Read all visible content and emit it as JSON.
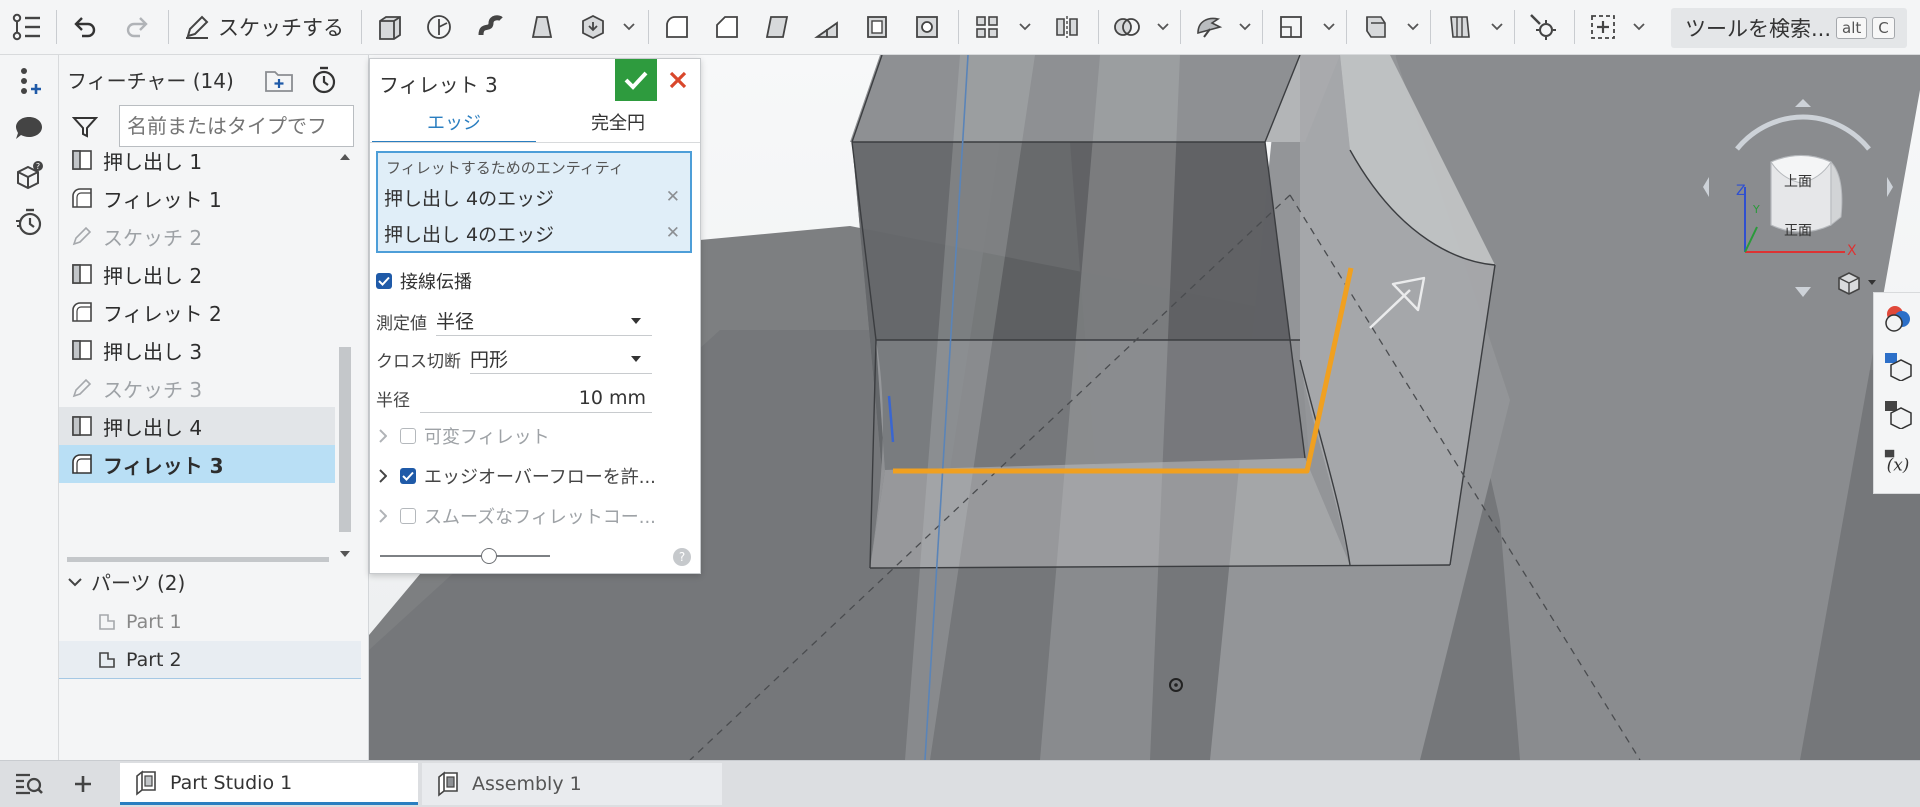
{
  "toolbar": {
    "sketch_label": "スケッチする",
    "search_label": "ツールを検索...",
    "search_key1": "alt",
    "search_key2": "C"
  },
  "feature_panel": {
    "title": "フィーチャー (14)",
    "filter_placeholder": "名前またはタイプでフ",
    "features": [
      {
        "label": "押し出し 1",
        "icon": "extrude-icon",
        "state": "normal"
      },
      {
        "label": "フィレット 1",
        "icon": "fillet-icon",
        "state": "normal"
      },
      {
        "label": "スケッチ 2",
        "icon": "sketch-icon",
        "state": "dim"
      },
      {
        "label": "押し出し 2",
        "icon": "extrude-icon",
        "state": "normal"
      },
      {
        "label": "フィレット 2",
        "icon": "fillet-icon",
        "state": "normal"
      },
      {
        "label": "押し出し 3",
        "icon": "extrude-icon",
        "state": "normal"
      },
      {
        "label": "スケッチ 3",
        "icon": "sketch-icon",
        "state": "dim"
      },
      {
        "label": "押し出し 4",
        "icon": "extrude-icon",
        "state": "hover"
      },
      {
        "label": "フィレット 3",
        "icon": "fillet-icon",
        "state": "selected"
      }
    ],
    "parts_header": "パーツ (2)",
    "parts": [
      {
        "label": "Part 1",
        "state": "normal"
      },
      {
        "label": "Part 2",
        "state": "selected"
      }
    ]
  },
  "dialog": {
    "title": "フィレット 3",
    "tab_edge": "エッジ",
    "tab_full_round": "完全円",
    "entity_caption": "フィレットするためのエンティティ",
    "entities": [
      "押し出し 4のエッジ",
      "押し出し 4のエッジ"
    ],
    "tangent_propagation": "接線伝播",
    "measure_label": "測定値",
    "measure_value": "半径",
    "cross_section_label": "クロス切断",
    "cross_section_value": "円形",
    "radius_label": "半径",
    "radius_value": "10 mm",
    "variable_fillet": "可変フィレット",
    "edge_overflow": "エッジオーバーフローを許...",
    "smooth_corner": "スムーズなフィレットコー...",
    "slider_fraction": 0.64
  },
  "view_cube": {
    "top_label": "上面",
    "front_label": "正面",
    "axis_x": "X",
    "axis_y": "Y",
    "axis_z": "Z"
  },
  "bottom_tabs": [
    {
      "label": "Part Studio 1",
      "active": true
    },
    {
      "label": "Assembly 1",
      "active": false
    }
  ],
  "colors": {
    "accent": "#2a7ec0",
    "selected_row": "#b9dff5",
    "ok_green": "#2e9b3e",
    "cancel_red": "#d9472b",
    "edge_highlight": "#f0a020"
  }
}
